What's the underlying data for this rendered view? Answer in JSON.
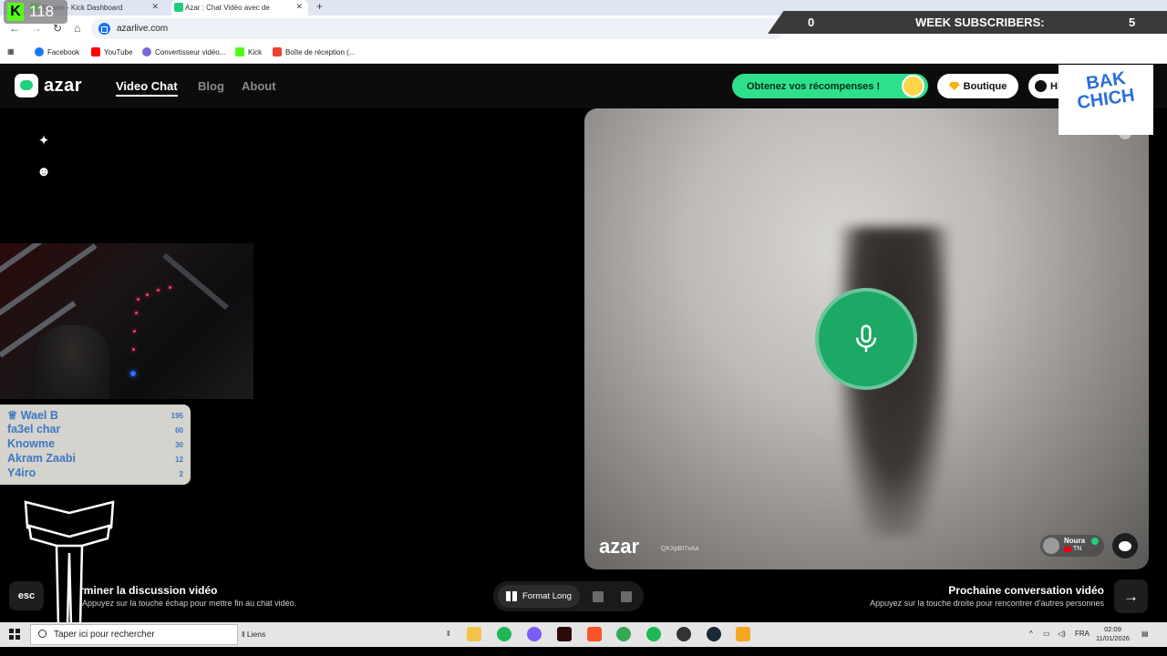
{
  "browser": {
    "tabs": [
      {
        "label": "Stream - Kick Dashboard",
        "active": false
      },
      {
        "label": "Azar : Chat Vidéo avec de",
        "active": true
      }
    ],
    "new_tab_label": "+",
    "url": "azarlive.com",
    "bookmarks": [
      {
        "label": "Facebook",
        "icon": "facebook-icon"
      },
      {
        "label": "YouTube",
        "icon": "youtube-icon"
      },
      {
        "label": "Convertisseur vidéo...",
        "icon": "converter-icon"
      },
      {
        "label": "Kick",
        "icon": "kick-icon"
      },
      {
        "label": "Boîte de réception (...",
        "icon": "gmail-icon"
      }
    ]
  },
  "stream_overlay": {
    "viewer_count": "118",
    "subs_left_value": "0",
    "subs_label": "WEEK SUBSCRIBERS:",
    "subs_value": "5",
    "sponsor_line1": "BAK",
    "sponsor_line2": "CHICH",
    "leaderboard": [
      {
        "name": "Wael B",
        "value": "195",
        "top": true
      },
      {
        "name": "fa3el char",
        "value": "60"
      },
      {
        "name": "Knowme",
        "value": "30"
      },
      {
        "name": "Akram Zaabi",
        "value": "12"
      },
      {
        "name": "Y4iro",
        "value": "2"
      }
    ]
  },
  "azar": {
    "logo_text": "azar",
    "nav": [
      {
        "label": "Video Chat",
        "active": true
      },
      {
        "label": "Blog",
        "active": false
      },
      {
        "label": "About",
        "active": false
      }
    ],
    "reward_label": "Obtenez vos récompenses !",
    "shop_label": "Boutique",
    "history_label": "Hi",
    "watermark": "azar",
    "watermark_code": "QKXpBI7xAa",
    "partner_name": "Noura",
    "partner_country": "TN",
    "accent": "#2ee08c",
    "mic_color": "#1ca865"
  },
  "bottom": {
    "esc_label": "esc",
    "end_title": "Terminer la discussion vidéo",
    "end_sub": "Appuyez sur la touche échap pour mettre fin au chat vidéo.",
    "format_label": "Format Long",
    "next_title": "Prochaine conversation vidéo",
    "next_sub": "Appuyez sur la touche droite pour rencontrer d'autres personnes",
    "next_arrow": "→"
  },
  "taskbar": {
    "search_placeholder": "Taper ici pour rechercher",
    "liens": "Liens",
    "language": "FRA",
    "time": "02:09",
    "date": "11/01/2026"
  }
}
